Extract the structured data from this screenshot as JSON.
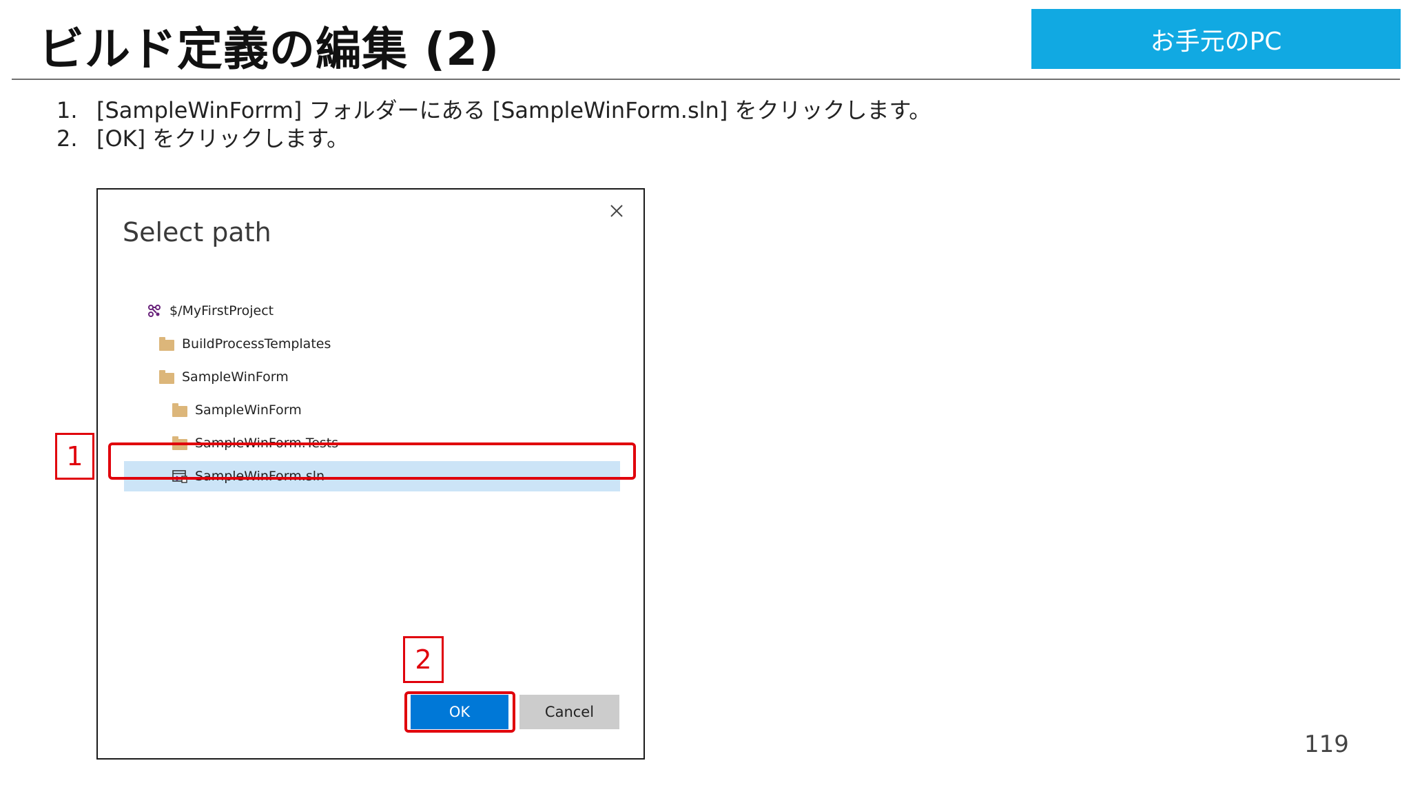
{
  "slide": {
    "title": "ビルド定義の編集 (2)",
    "badge": "お手元のPC",
    "page_number": "119",
    "steps": [
      {
        "number": "1.",
        "text": "[SampleWinForrm] フォルダーにある [SampleWinForm.sln] をクリックします。"
      },
      {
        "number": "2.",
        "text": "[OK] をクリックします。"
      }
    ],
    "callouts": [
      {
        "label": "1"
      },
      {
        "label": "2"
      }
    ]
  },
  "dialog": {
    "title": "Select path",
    "tree": [
      {
        "label": "$/MyFirstProject",
        "icon": "team-project-icon"
      },
      {
        "label": "BuildProcessTemplates",
        "icon": "folder-icon"
      },
      {
        "label": "SampleWinForm",
        "icon": "folder-icon"
      },
      {
        "label": "SampleWinForm",
        "icon": "folder-icon"
      },
      {
        "label": "SampleWinForm.Tests",
        "icon": "folder-icon"
      },
      {
        "label": "SampleWinForm.sln",
        "icon": "solution-file-icon",
        "selected": true
      }
    ],
    "ok_label": "OK",
    "cancel_label": "Cancel"
  },
  "colors": {
    "badge": "#11A9E2",
    "highlight": "#E0000B",
    "ok_button": "#0078D7",
    "selection": "#CCE4F7",
    "folder": "#DCB67A",
    "project_icon": "#68217A"
  }
}
